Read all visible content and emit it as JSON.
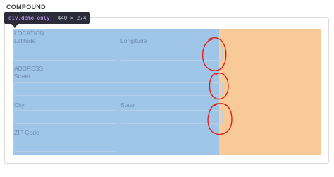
{
  "section": {
    "title": "COMPOUND"
  },
  "tooltip": {
    "selector": "div.demo-only",
    "dimensions": "440 × 274"
  },
  "location": {
    "legend": "LOCATION",
    "latitude_label": "Latitude",
    "longitude_label": "Longitude",
    "latitude_value": "",
    "longitude_value": ""
  },
  "address": {
    "legend": "ADDRESS",
    "street_label": "Street",
    "city_label": "City",
    "state_label": "State",
    "zip_label": "ZIP Code",
    "street_value": "",
    "city_value": "",
    "state_value": "",
    "zip_value": ""
  },
  "colors": {
    "content_highlight": "#9fc5e8",
    "padding_highlight": "#f7ca98",
    "annotation": "#e0201c"
  }
}
